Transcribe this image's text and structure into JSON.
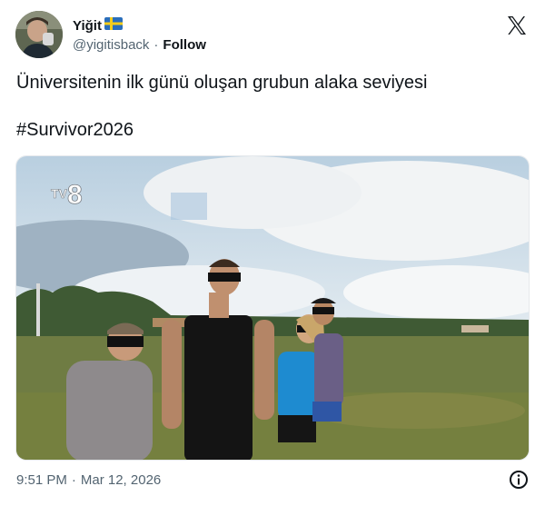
{
  "author": {
    "display_name": "Yiğit",
    "flag_icon": "sweden-flag-icon",
    "handle": "@yigitisback",
    "follow_label": "Follow",
    "separator": "·"
  },
  "tweet": {
    "text": "Üniversitenin ilk günü oluşan grubun alaka seviyesi",
    "hashtag": "#Survivor2026"
  },
  "media": {
    "channel_logo": "TV8"
  },
  "footer": {
    "time": "9:51 PM",
    "separator": "·",
    "date": "Mar 12, 2026"
  },
  "icons": {
    "x_logo": "x-logo-icon",
    "info": "info-icon"
  },
  "colors": {
    "text_primary": "#0f1419",
    "text_secondary": "#536471"
  }
}
